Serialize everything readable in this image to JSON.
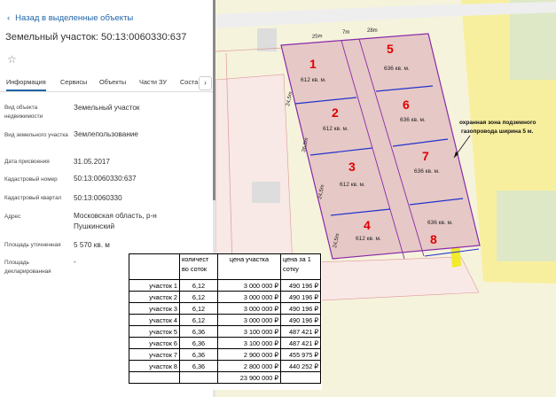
{
  "panel": {
    "back_label": "Назад в выделенные объекты",
    "title": "Земельный участок: 50:13:0060330:637",
    "tabs": [
      "Информация",
      "Сервисы",
      "Объекты",
      "Части ЗУ",
      "Соста"
    ],
    "info": [
      {
        "label": "Вид объекта недвижимости",
        "value": "Земельный участок"
      },
      {
        "label": "Вид земельного участка",
        "value": "Землепользование"
      },
      {
        "label": "Дата присвоения",
        "value": "31.05.2017"
      },
      {
        "label": "Кадастровый номер",
        "value": "50:13:0060330:637"
      },
      {
        "label": "Кадастровый квартал",
        "value": "50:13:0060330"
      },
      {
        "label": "Адрес",
        "value": "Московская область, р-н Пушкинский"
      },
      {
        "label": "Площадь уточненная",
        "value": "5 570 кв. м"
      },
      {
        "label": "Площадь декларированная",
        "value": "-"
      }
    ]
  },
  "map": {
    "plots": [
      {
        "num": "1",
        "area": "612 кв. м."
      },
      {
        "num": "2",
        "area": "612 кв. м."
      },
      {
        "num": "3",
        "area": "612 кв. м."
      },
      {
        "num": "4",
        "area": "612 кв. м."
      },
      {
        "num": "5",
        "area": "636 кв. м."
      },
      {
        "num": "6",
        "area": "636 кв. м."
      },
      {
        "num": "7",
        "area": "636 кв. м."
      },
      {
        "num": "8",
        "area": "636 кв. м."
      }
    ],
    "dimensions": [
      "25m",
      "7m",
      "28m",
      "24,5m",
      "36,5m",
      "24,5m",
      "24,5m"
    ],
    "zone_note_1": "охранная зона подземного",
    "zone_note_2": "газопровода ширина 5 м.",
    "colors": {
      "plot_fill": "#e6c8c6",
      "plot_outline": "#8a2aa8",
      "inner_lines": "#2233cc",
      "zone": "#f2ea2a",
      "number": "#e00000"
    }
  },
  "price_table": {
    "headers": [
      "",
      "количест во соток",
      "цена участка",
      "цена за 1 сотку"
    ],
    "rows": [
      [
        "участок 1",
        "6,12",
        "3 000 000 ₽",
        "490 196 ₽"
      ],
      [
        "участок 2",
        "6,12",
        "3 000 000 ₽",
        "490 196 ₽"
      ],
      [
        "участок 3",
        "6,12",
        "3 000 000 ₽",
        "490 196 ₽"
      ],
      [
        "участок 4",
        "6,12",
        "3 000 000 ₽",
        "490 196 ₽"
      ],
      [
        "участок 5",
        "6,36",
        "3 100 000 ₽",
        "487 421 ₽"
      ],
      [
        "участок 6",
        "6,36",
        "3 100 000 ₽",
        "487 421 ₽"
      ],
      [
        "участок 7",
        "6,36",
        "2 900 000 ₽",
        "455 975 ₽"
      ],
      [
        "участок 8",
        "6,36",
        "2 800 000 ₽",
        "440 252 ₽"
      ]
    ],
    "total": "23 900 000 ₽"
  }
}
